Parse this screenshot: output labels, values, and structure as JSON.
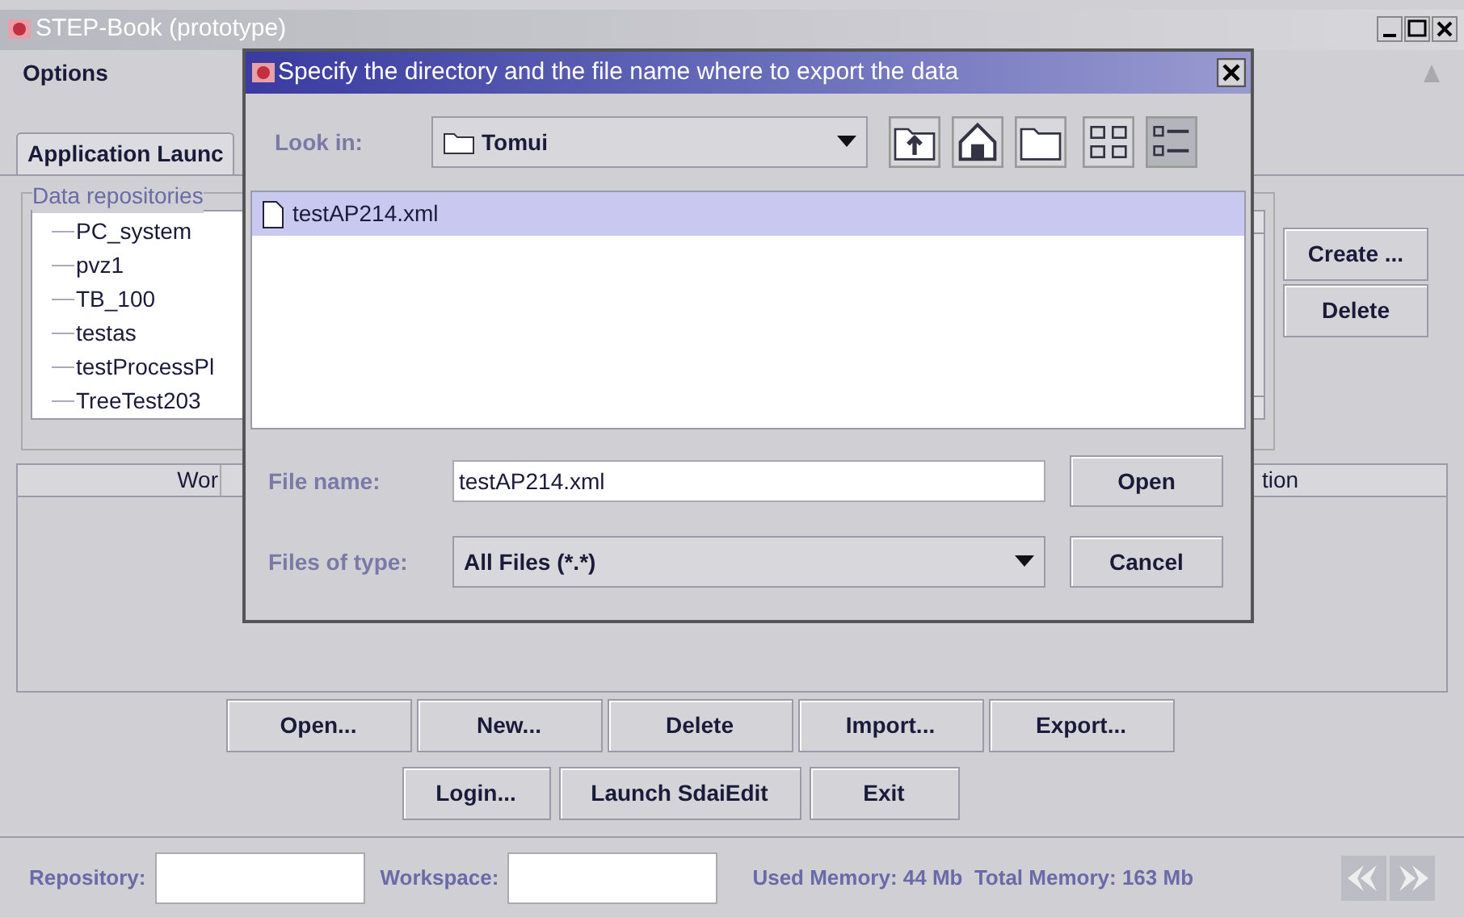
{
  "window": {
    "title": "STEP-Book (prototype)"
  },
  "menu": [
    "Options"
  ],
  "tabs": [
    {
      "label": "Application Launc",
      "selected": true
    }
  ],
  "data_repositories": {
    "title": "Data repositories",
    "items": [
      "PC_system",
      "pvz1",
      "TB_100",
      "testas",
      "testProcessPl",
      "TreeTest203"
    ],
    "buttons": [
      "Create ...",
      "Delete"
    ]
  },
  "workspace_table": {
    "columns": [
      {
        "label": "Wor"
      },
      {
        "label": "tion"
      }
    ]
  },
  "buttons_row_1": [
    "Open...",
    "New...",
    "Delete",
    "Import...",
    "Export..."
  ],
  "buttons_row_2": [
    "Login...",
    "Launch SdaiEdit",
    "Exit"
  ],
  "status_bar": {
    "repository_label": "Repository:",
    "workspace_label": "Workspace:",
    "memory": "Used Memory: 44 Mb  Total Memory: 163 Mb"
  },
  "dialog": {
    "title": "Specify the directory and the file name where to export the data",
    "look_in": {
      "label": "Look in:",
      "value": "Tomui"
    },
    "files": [
      {
        "name": "testAP214.xml",
        "selected": true
      }
    ],
    "file_name": {
      "label": "File name:",
      "value": "testAP214.xml"
    },
    "files_of_type": {
      "label": "Files of type:",
      "value": "All Files (*.*)"
    },
    "buttons": [
      "Open",
      "Cancel"
    ]
  }
}
